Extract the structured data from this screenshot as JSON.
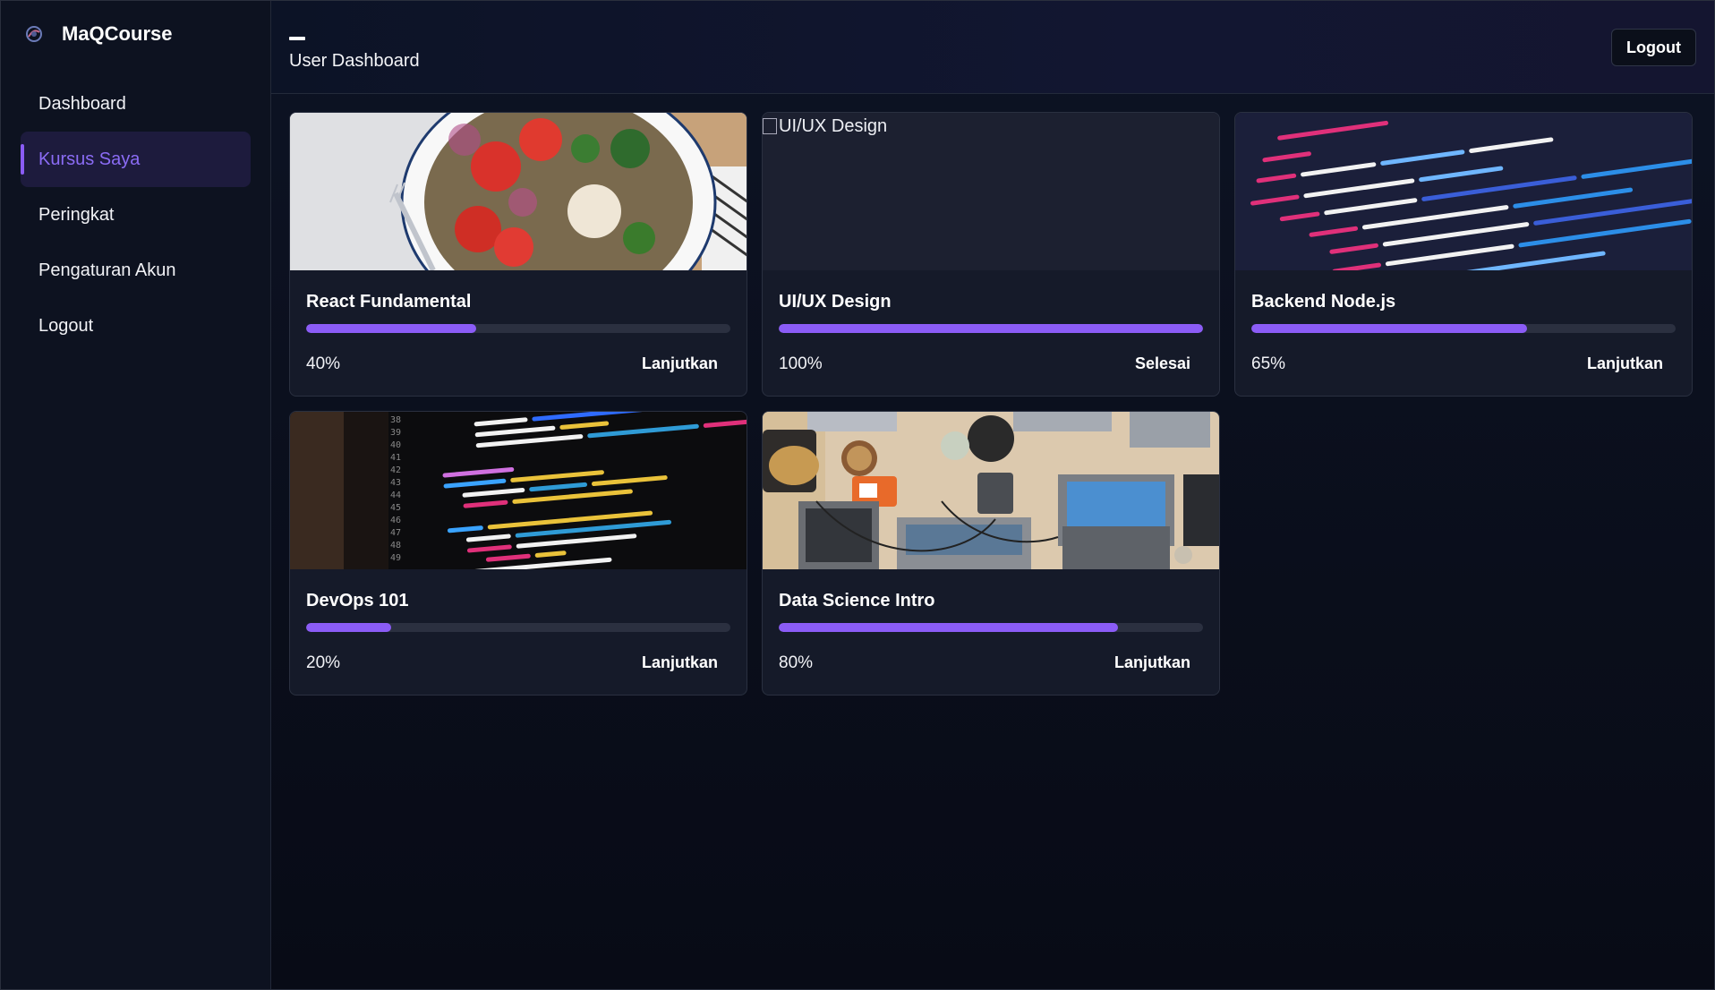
{
  "brand": {
    "name": "MaQCourse"
  },
  "sidebar": {
    "items": [
      {
        "label": "Dashboard",
        "active": false
      },
      {
        "label": "Kursus Saya",
        "active": true
      },
      {
        "label": "Peringkat",
        "active": false
      },
      {
        "label": "Pengaturan Akun",
        "active": false
      },
      {
        "label": "Logout",
        "active": false
      }
    ]
  },
  "header": {
    "title": "User Dashboard",
    "logout_label": "Logout"
  },
  "courses": [
    {
      "title": "React Fundamental",
      "progress_pct": 40,
      "progress_text": "40%",
      "action": "Lanjutkan",
      "image": "food-salad-photo"
    },
    {
      "title": "UI/UX Design",
      "progress_pct": 100,
      "progress_text": "100%",
      "action": "Selesai",
      "image_alt": "UI/UX Design",
      "image": "broken-image"
    },
    {
      "title": "Backend Node.js",
      "progress_pct": 65,
      "progress_text": "65%",
      "action": "Lanjutkan",
      "image": "code-screen-photo"
    },
    {
      "title": "DevOps 101",
      "progress_pct": 20,
      "progress_text": "20%",
      "action": "Lanjutkan",
      "image": "python-code-photo"
    },
    {
      "title": "Data Science Intro",
      "progress_pct": 80,
      "progress_text": "80%",
      "action": "Lanjutkan",
      "image": "desk-laptops-photo"
    }
  ],
  "colors": {
    "accent": "#8b5cf6",
    "card_bg": "#151a29",
    "sidebar_bg": "#0d1220"
  }
}
